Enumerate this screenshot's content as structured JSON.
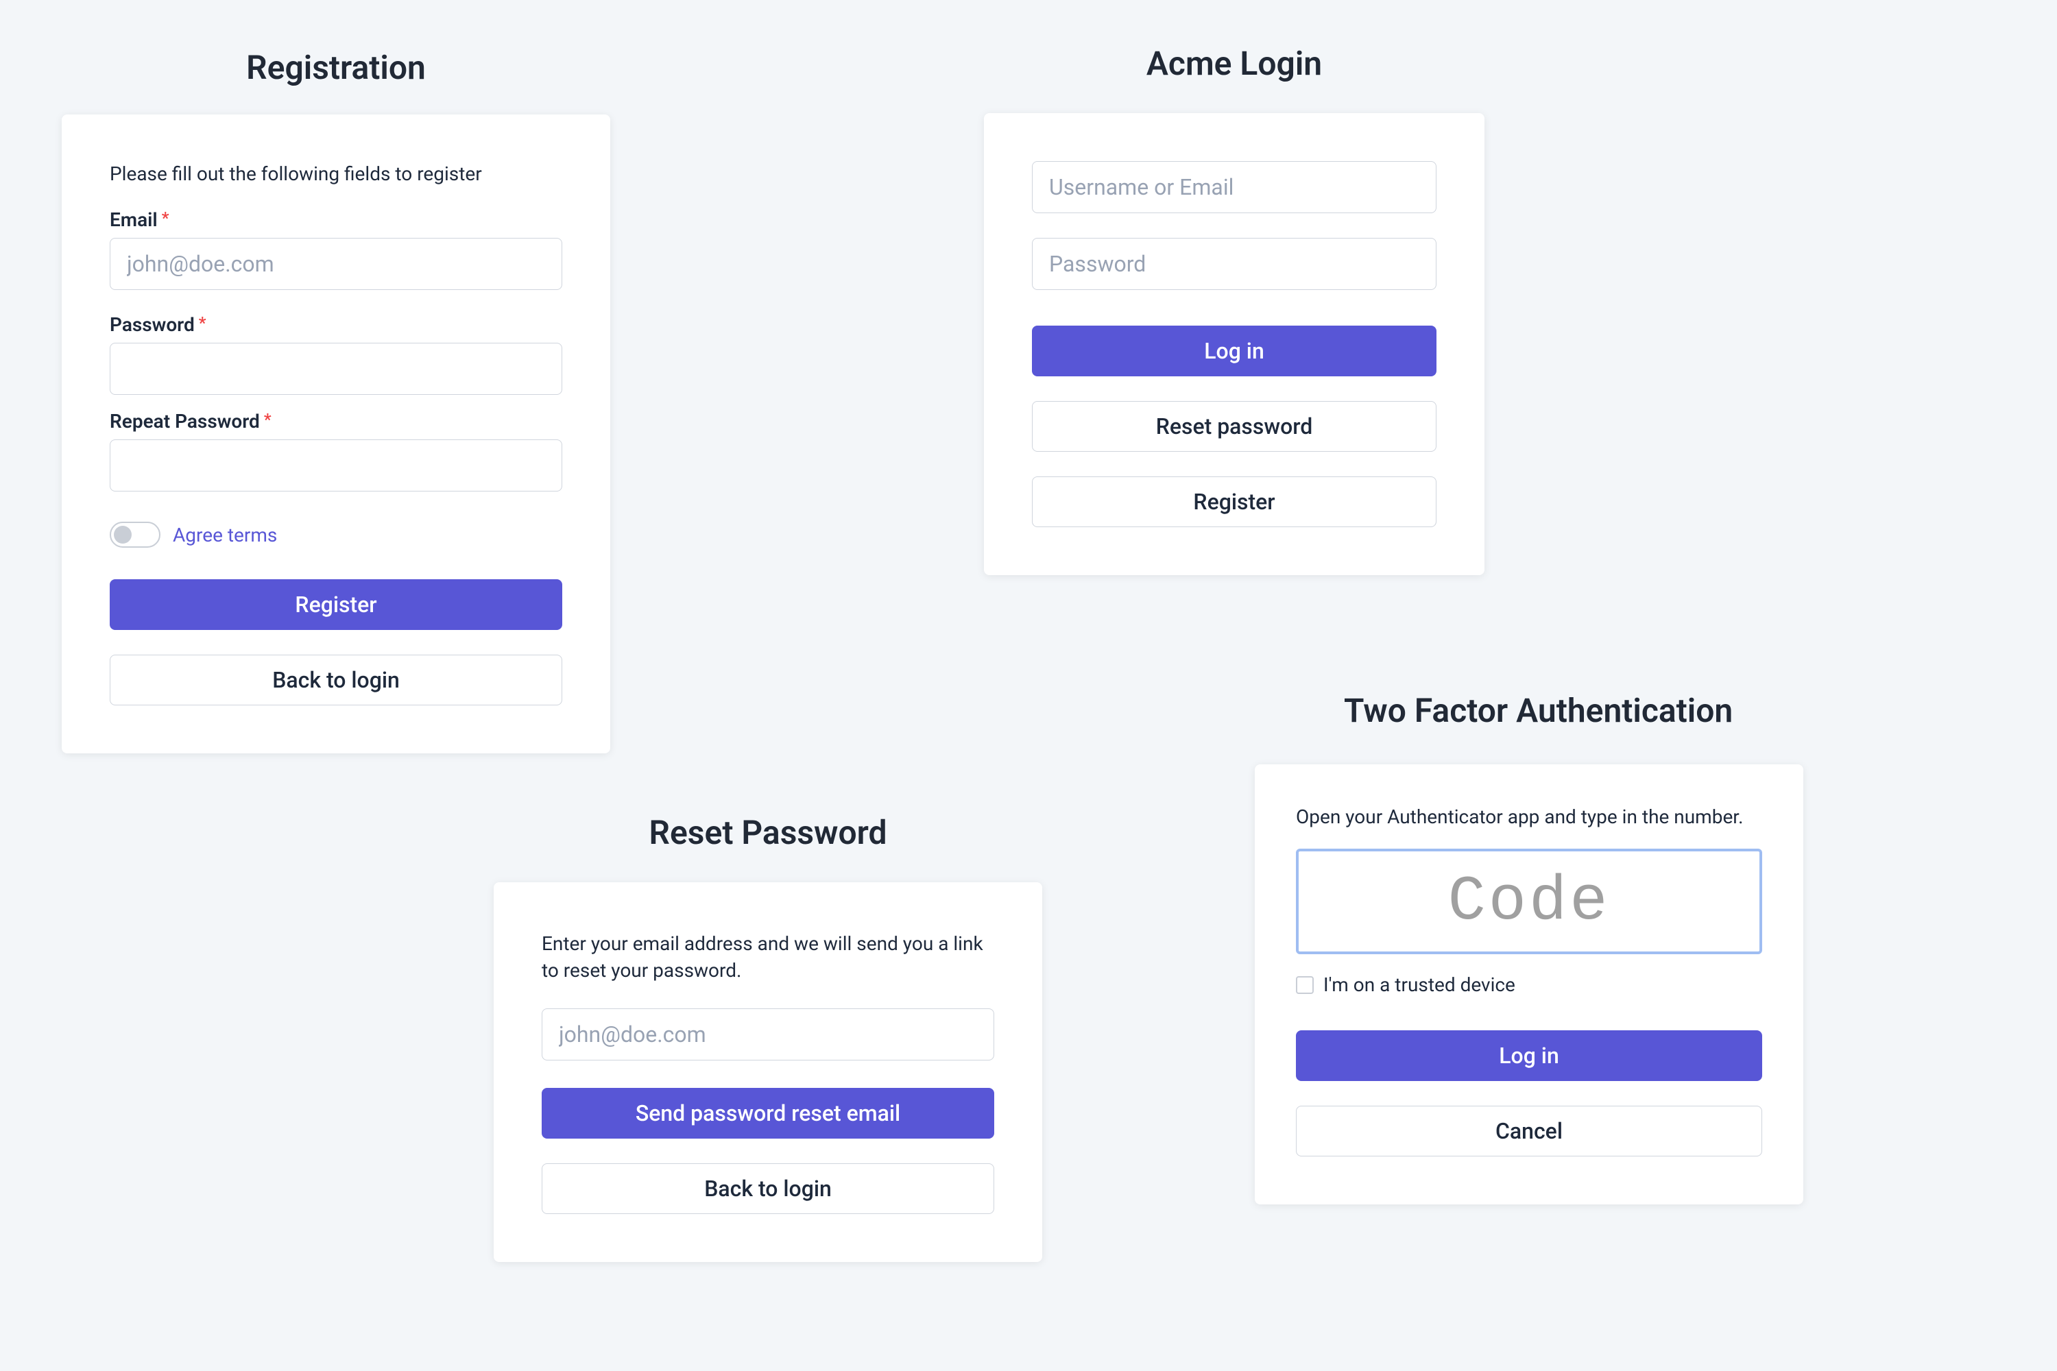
{
  "registration": {
    "title": "Registration",
    "instruction": "Please fill out the following fields to register",
    "email_label": "Email",
    "email_placeholder": "john@doe.com",
    "password_label": "Password",
    "repeat_password_label": "Repeat Password",
    "agree_terms": "Agree terms",
    "register_button": "Register",
    "back_button": "Back to login"
  },
  "login": {
    "title": "Acme Login",
    "username_placeholder": "Username or Email",
    "password_placeholder": "Password",
    "login_button": "Log in",
    "reset_button": "Reset password",
    "register_button": "Register"
  },
  "reset": {
    "title": "Reset Password",
    "instruction": "Enter your email address and we will send you a link to reset your password.",
    "email_placeholder": "john@doe.com",
    "send_button": "Send password reset email",
    "back_button": "Back to login"
  },
  "tfa": {
    "title": "Two Factor Authentication",
    "instruction": "Open your Authenticator app and type in the number.",
    "code_placeholder": "Code",
    "trusted_label": "I'm on a trusted device",
    "login_button": "Log in",
    "cancel_button": "Cancel"
  }
}
